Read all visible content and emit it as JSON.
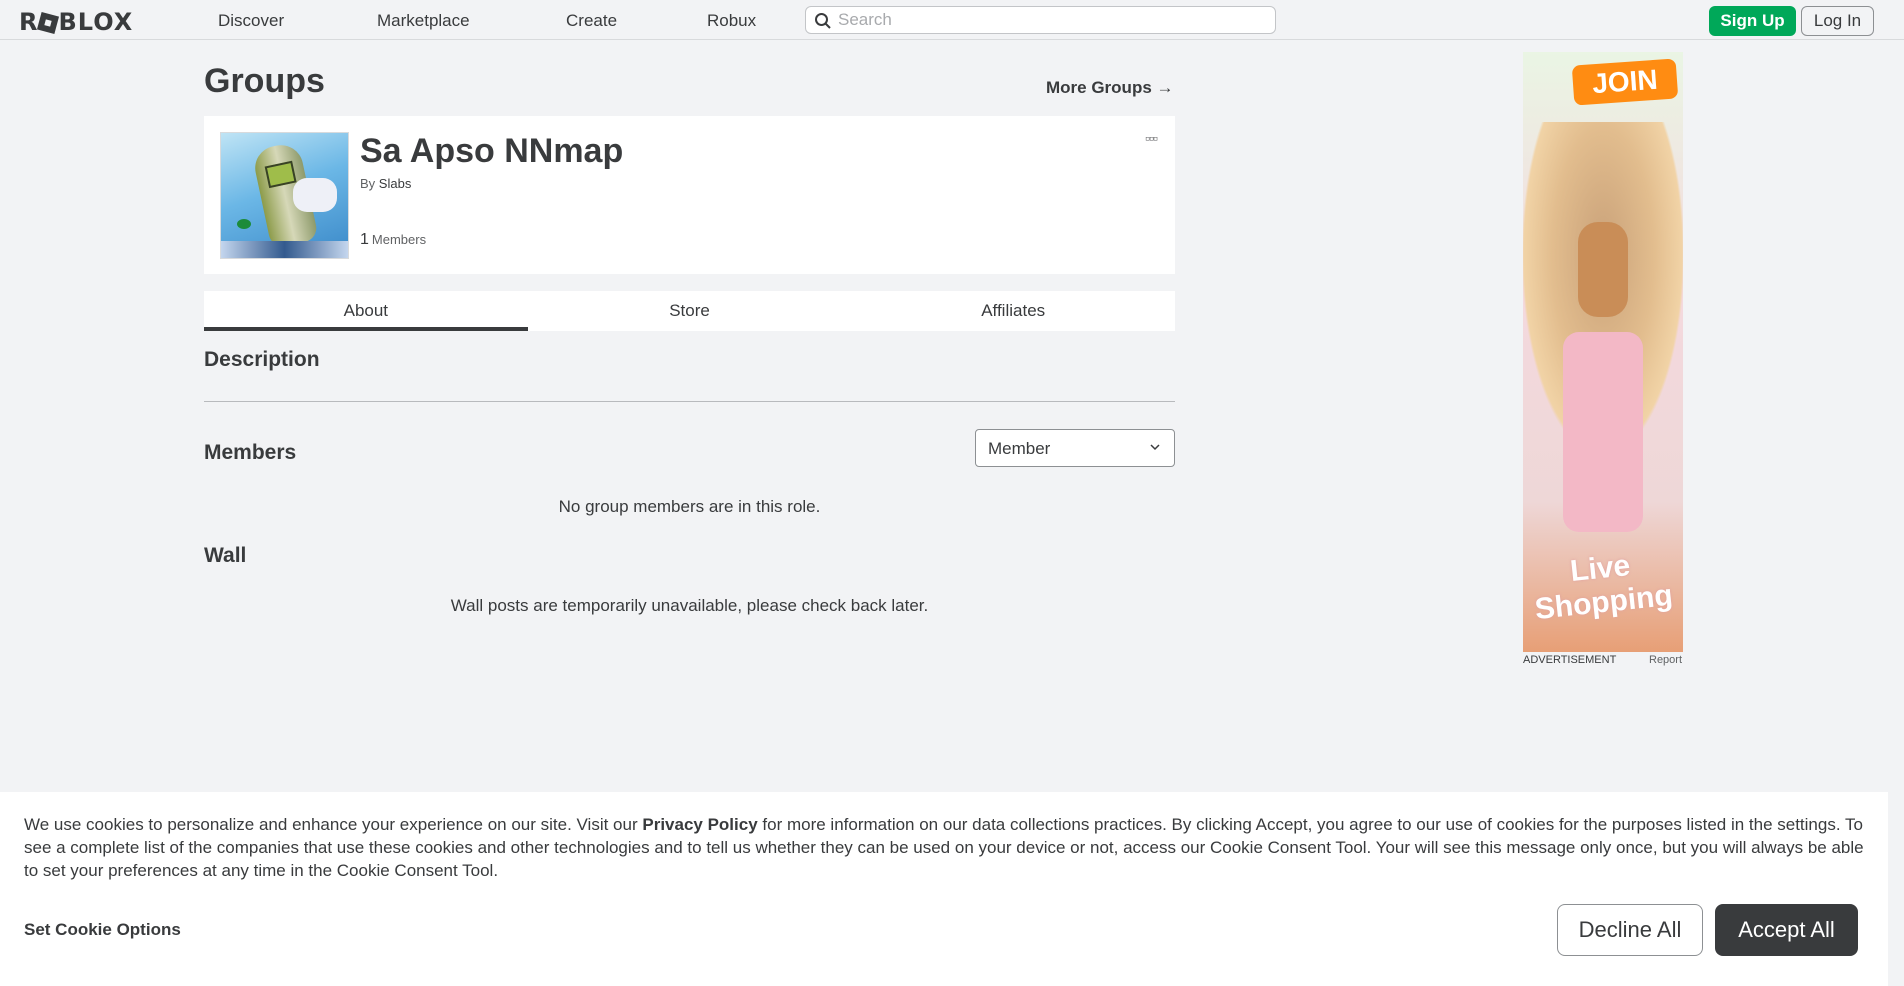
{
  "nav": {
    "logo": "ROBLOX",
    "links": [
      "Discover",
      "Marketplace",
      "Create",
      "Robux"
    ],
    "search_placeholder": "Search",
    "signup": "Sign Up",
    "login": "Log In"
  },
  "groups": {
    "title": "Groups",
    "more": "More Groups →"
  },
  "group": {
    "name": "Sa Apso NNmap",
    "by_label": "By",
    "owner": "Slabs",
    "member_count": "1",
    "members_label": "Members",
    "more_icon": "more-dots-icon"
  },
  "tabs": [
    "About",
    "Store",
    "Affiliates"
  ],
  "about": {
    "description_heading": "Description",
    "members_heading": "Members",
    "role_selected": "Member",
    "no_members": "No group members are in this role.",
    "wall_heading": "Wall",
    "wall_message": "Wall posts are temporarily unavailable, please check back later."
  },
  "ad": {
    "join": "JOIN",
    "label": "ADVERTISEMENT",
    "report": "Report",
    "art_text": "Live Shopping"
  },
  "cookie": {
    "text_before": "We use cookies to personalize and enhance your experience on our site. Visit our ",
    "privacy_link": "Privacy Policy",
    "text_after": " for more information on our data collections practices. By clicking Accept, you agree to our use of cookies for the purposes listed in the settings. To see a complete list of the companies that use these cookies and other technologies and to tell us whether they can be used on your device or not, access our Cookie Consent Tool. Your will see this message only once, but you will always be able to set your preferences at any time in the Cookie Consent Tool.",
    "set_options": "Set Cookie Options",
    "decline": "Decline All",
    "accept": "Accept All"
  },
  "colors": {
    "signup_green": "#00a859",
    "accept_dark": "#393b3d",
    "ad_orange": "#ff8c12"
  }
}
